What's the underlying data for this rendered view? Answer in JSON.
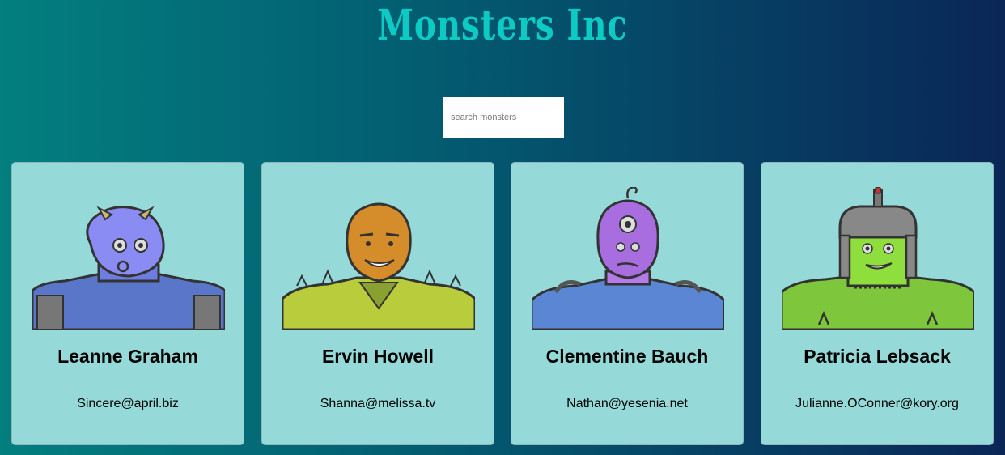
{
  "app": {
    "title": "Monsters Inc"
  },
  "search": {
    "placeholder": "search monsters"
  },
  "monsters": [
    {
      "name": "Leanne Graham",
      "email": "Sincere@april.biz"
    },
    {
      "name": "Ervin Howell",
      "email": "Shanna@melissa.tv"
    },
    {
      "name": "Clementine Bauch",
      "email": "Nathan@yesenia.net"
    },
    {
      "name": "Patricia Lebsack",
      "email": "Julianne.OConner@kory.org"
    }
  ],
  "colors": {
    "title": "#0ccac4",
    "card_background": "#95dad8",
    "gradient_start": "#037f7f",
    "gradient_end": "#0a2657"
  }
}
